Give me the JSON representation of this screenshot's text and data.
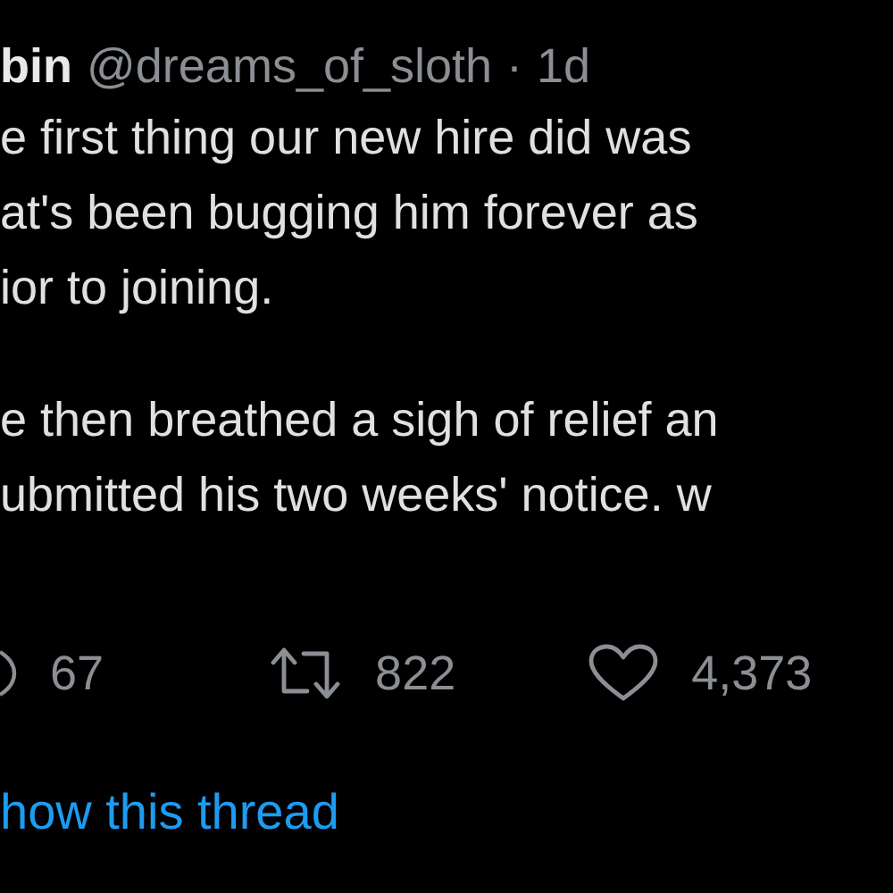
{
  "tweet": {
    "name": "bin",
    "handle": "@dreams_of_sloth",
    "separator": "·",
    "time": "1d",
    "paragraphs": [
      [
        "e first thing our new hire did was",
        "at's been bugging him forever as",
        "ior to joining."
      ],
      [
        "e then breathed a sigh of relief an",
        "ubmitted his two weeks' notice. w"
      ]
    ],
    "actions": [
      {
        "kind": "reply",
        "count": "67"
      },
      {
        "kind": "retweet",
        "count": "822"
      },
      {
        "kind": "like",
        "count": "4,373"
      }
    ],
    "thread_link": "how this thread"
  }
}
